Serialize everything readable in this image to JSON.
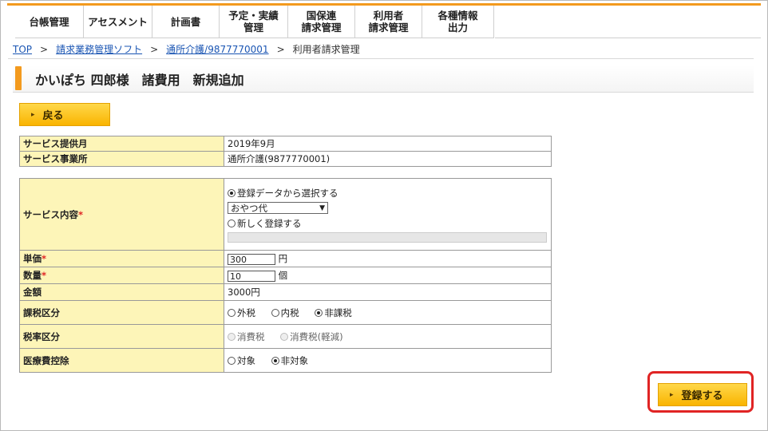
{
  "nav": {
    "items": [
      {
        "label": "台帳管理",
        "line2": ""
      },
      {
        "label": "アセスメント",
        "line2": ""
      },
      {
        "label": "計画書",
        "line2": ""
      },
      {
        "label": "予定・実績",
        "line2": "管理"
      },
      {
        "label": "国保連",
        "line2": "請求管理"
      },
      {
        "label": "利用者",
        "line2": "請求管理"
      },
      {
        "label": "各種情報",
        "line2": "出力"
      }
    ]
  },
  "breadcrumb": {
    "top": "TOP",
    "soft": "請求業務管理ソフト",
    "office": "通所介護/9877770001",
    "current": "利用者請求管理",
    "sep": ">"
  },
  "page": {
    "title": "かいぽち 四郎様　諸費用　新規追加"
  },
  "buttons": {
    "back": "戻る",
    "register": "登録する"
  },
  "info": {
    "month_label": "サービス提供月",
    "month_value": "2019年9月",
    "office_label": "サービス事業所",
    "office_value": "通所介護(9877770001)"
  },
  "form": {
    "service_label": "サービス内容",
    "required_mark": "*",
    "select_from_data": "登録データから選択する",
    "selected_item": "おやつ代",
    "register_new": "新しく登録する",
    "unit_price_label": "単価",
    "unit_price_value": "300",
    "unit_price_suffix": "円",
    "quantity_label": "数量",
    "quantity_value": "10",
    "quantity_suffix": "個",
    "amount_label": "金額",
    "amount_value": "3000円",
    "tax_label": "課税区分",
    "tax_options": [
      "外税",
      "内税",
      "非課税"
    ],
    "tax_selected": "非課税",
    "taxrate_label": "税率区分",
    "taxrate_options": [
      "消費税",
      "消費税(軽減)"
    ],
    "medical_label": "医療費控除",
    "medical_options": [
      "対象",
      "非対象"
    ],
    "medical_selected": "非対象"
  },
  "colors": {
    "accent": "#f39a1e",
    "button": "#f9b400",
    "header_cell": "#fdf5b8",
    "highlight": "#e02424"
  }
}
